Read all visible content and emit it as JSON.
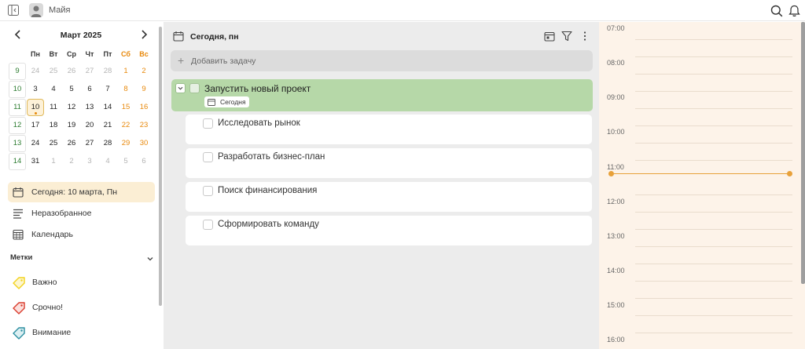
{
  "topbar": {
    "username": "Майя",
    "icons": [
      "sidebar-toggle-icon",
      "user-avatar-icon",
      "search-icon",
      "bell-icon"
    ]
  },
  "calendar": {
    "month_label": "Март 2025",
    "weekday_headers": [
      "Пн",
      "Вт",
      "Ср",
      "Чт",
      "Пт",
      "Сб",
      "Вс"
    ],
    "weeks": [
      {
        "week": "9",
        "days": [
          "24",
          "25",
          "26",
          "27",
          "28",
          "1",
          "2"
        ]
      },
      {
        "week": "10",
        "days": [
          "3",
          "4",
          "5",
          "6",
          "7",
          "8",
          "9"
        ]
      },
      {
        "week": "11",
        "days": [
          "10",
          "11",
          "12",
          "13",
          "14",
          "15",
          "16"
        ]
      },
      {
        "week": "12",
        "days": [
          "17",
          "18",
          "19",
          "20",
          "21",
          "22",
          "23"
        ]
      },
      {
        "week": "13",
        "days": [
          "24",
          "25",
          "26",
          "27",
          "28",
          "29",
          "30"
        ]
      },
      {
        "week": "14",
        "days": [
          "31",
          "1",
          "2",
          "3",
          "4",
          "5",
          "6"
        ]
      }
    ],
    "selected_day": "10",
    "accent_color": "#e8890c",
    "week_number_color": "#2e7d32"
  },
  "nav": {
    "today": "Сегодня: 10 марта, Пн",
    "inbox": "Неразобранное",
    "calendar": "Календарь"
  },
  "tags": {
    "header": "Метки",
    "items": [
      {
        "label": "Важно",
        "color": "#f2d21b"
      },
      {
        "label": "Срочно!",
        "color": "#d93a2b"
      },
      {
        "label": "Внимание",
        "color": "#2a8ea0"
      }
    ]
  },
  "tasks": {
    "header_title": "Сегодня, пн",
    "add_task_placeholder": "Добавить задачу",
    "main_task": {
      "title": "Запустить новый проект",
      "badge": "Сегодня",
      "color": "#b6d8a8"
    },
    "subtasks": [
      "Исследовать рынок",
      "Разработать бизнес-план",
      "Поиск финансирования",
      "Сформировать команду"
    ]
  },
  "timeline": {
    "hours": [
      "07:00",
      "08:00",
      "09:00",
      "10:00",
      "11:00",
      "12:00",
      "13:00",
      "14:00",
      "15:00",
      "16:00"
    ],
    "now_color": "#e8a13a"
  }
}
